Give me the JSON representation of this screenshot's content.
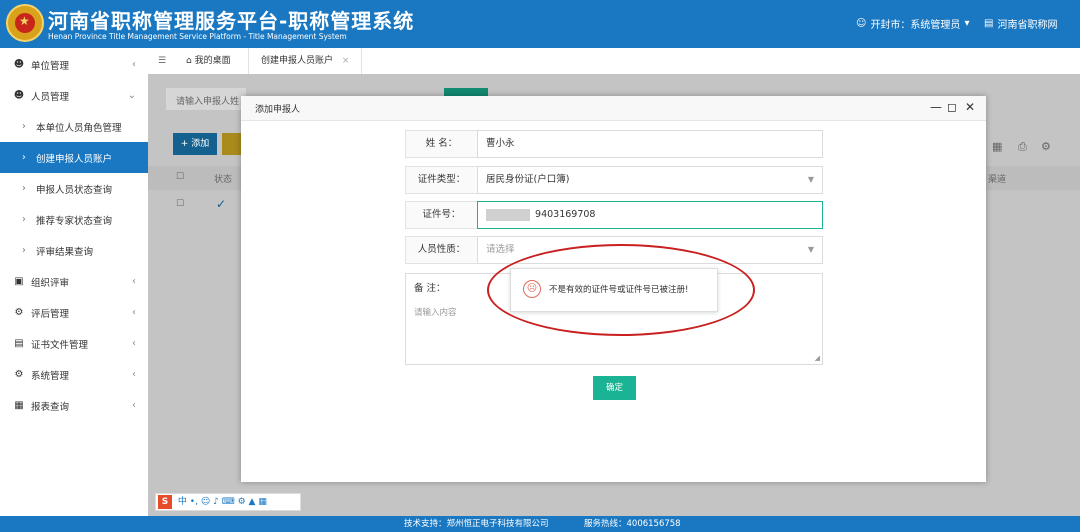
{
  "header": {
    "title_cn": "河南省职称管理服务平台-职称管理系统",
    "title_en": "Henan Province Title Management Service Platform - Title Management System",
    "user_label": "开封市：系统管理员",
    "portal_label": "河南省职称网"
  },
  "sidebar": {
    "items": [
      {
        "label": "单位管理",
        "icon": "user-icon",
        "arrow": "<"
      },
      {
        "label": "人员管理",
        "icon": "user-icon",
        "arrow": "v"
      },
      {
        "label": "本单位人员角色管理"
      },
      {
        "label": "创建申报人员账户"
      },
      {
        "label": "申报人员状态查询"
      },
      {
        "label": "推荐专家状态查询"
      },
      {
        "label": "评审结果查询"
      },
      {
        "label": "组织评审",
        "icon": "review-icon",
        "arrow": "<"
      },
      {
        "label": "评后管理",
        "icon": "settings-icon",
        "arrow": "<"
      },
      {
        "label": "证书文件管理",
        "icon": "certificate-icon",
        "arrow": "<"
      },
      {
        "label": "系统管理",
        "icon": "gear-icon",
        "arrow": "<"
      },
      {
        "label": "报表查询",
        "icon": "report-icon",
        "arrow": "<"
      }
    ]
  },
  "tabs": {
    "home": "我的桌面",
    "current": "创建申报人员账户"
  },
  "background": {
    "search_placeholder": "请输入申报人姓",
    "add_button": "+ 添加",
    "col_status": "状态",
    "col_end": "渠道"
  },
  "modal": {
    "title": "添加申报人",
    "fields": {
      "name_label": "姓 名：",
      "name_value": "曹小永",
      "idtype_label": "证件类型：",
      "idtype_value": "居民身份证(户口簿)",
      "idno_label": "证件号：",
      "idno_value": "9403169708",
      "nature_label": "人员性质：",
      "nature_placeholder": "请选择",
      "remark_label": "备 注：",
      "remark_placeholder": "请输入内容"
    },
    "error_message": "不是有效的证件号或证件号已被注册!",
    "confirm_button": "确定"
  },
  "ime": {
    "logo": "S",
    "mode": "中"
  },
  "footer": {
    "support": "技术支持：郑州恒正电子科技有限公司",
    "hotline": "服务热线：4006156758"
  },
  "colors": {
    "brand_blue": "#1a78c2",
    "confirm_green": "#1ab394",
    "highlight_red": "#c91f1f"
  }
}
